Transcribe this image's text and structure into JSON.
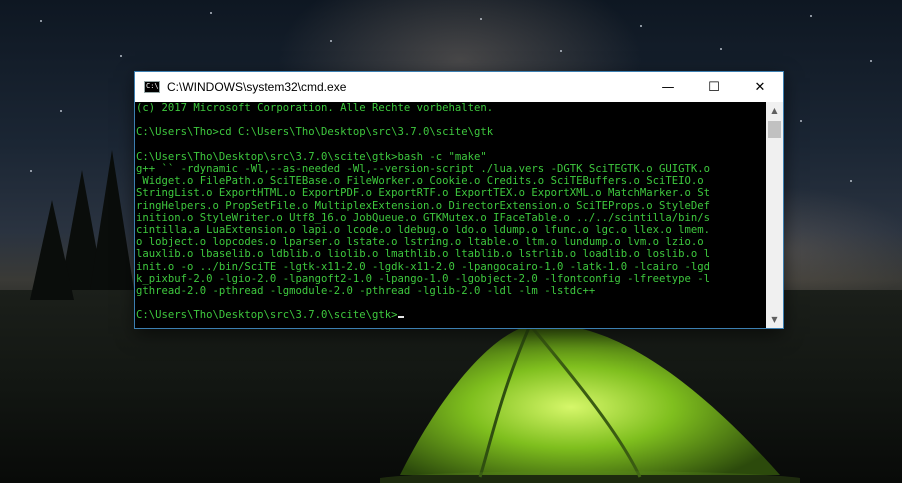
{
  "window": {
    "title": "C:\\WINDOWS\\system32\\cmd.exe",
    "icon_text": "C:\\",
    "buttons": {
      "minimize": "—",
      "maximize": "☐",
      "close": "✕"
    }
  },
  "console": {
    "lines": [
      "(c) 2017 Microsoft Corporation. Alle Rechte vorbehalten.",
      "",
      "C:\\Users\\Tho>cd C:\\Users\\Tho\\Desktop\\src\\3.7.0\\scite\\gtk",
      "",
      "C:\\Users\\Tho\\Desktop\\src\\3.7.0\\scite\\gtk>bash -c \"make\"",
      "g++ `` -rdynamic -Wl,--as-needed -Wl,--version-script ./lua.vers -DGTK SciTEGTK.o GUIGTK.o",
      " Widget.o FilePath.o SciTEBase.o FileWorker.o Cookie.o Credits.o SciTEBuffers.o SciTEIO.o",
      "StringList.o ExportHTML.o ExportPDF.o ExportRTF.o ExportTEX.o ExportXML.o MatchMarker.o St",
      "ringHelpers.o PropSetFile.o MultiplexExtension.o DirectorExtension.o SciTEProps.o StyleDef",
      "inition.o StyleWriter.o Utf8_16.o JobQueue.o GTKMutex.o IFaceTable.o ../../scintilla/bin/s",
      "cintilla.a LuaExtension.o lapi.o lcode.o ldebug.o ldo.o ldump.o lfunc.o lgc.o llex.o lmem.",
      "o lobject.o lopcodes.o lparser.o lstate.o lstring.o ltable.o ltm.o lundump.o lvm.o lzio.o",
      "lauxlib.o lbaselib.o ldblib.o liolib.o lmathlib.o ltablib.o lstrlib.o loadlib.o loslib.o l",
      "init.o -o ../bin/SciTE -lgtk-x11-2.0 -lgdk-x11-2.0 -lpangocairo-1.0 -latk-1.0 -lcairo -lgd",
      "k_pixbuf-2.0 -lgio-2.0 -lpangoft2-1.0 -lpango-1.0 -lgobject-2.0 -lfontconfig -lfreetype -l",
      "gthread-2.0 -pthread -lgmodule-2.0 -pthread -lglib-2.0 -ldl -lm -lstdc++",
      "",
      "C:\\Users\\Tho\\Desktop\\src\\3.7.0\\scite\\gtk>"
    ]
  },
  "scrollbar": {
    "up": "▲",
    "down": "▼"
  },
  "colors": {
    "console_text": "#3ec83e",
    "console_bg": "#000000",
    "window_border": "#3c7fb1"
  },
  "icons": {
    "app": "cmd-icon",
    "minimize": "minimize-icon",
    "maximize": "maximize-icon",
    "close": "close-icon"
  }
}
